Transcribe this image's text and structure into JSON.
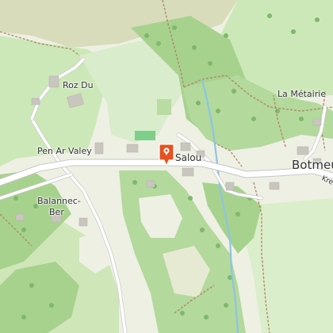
{
  "map": {
    "places": [
      {
        "name": "Roz Du",
        "kind": "hamlet"
      },
      {
        "name": "Pen Ar Valey",
        "kind": "locality"
      },
      {
        "name": "Salou",
        "kind": "locality"
      },
      {
        "name": "La Métairie",
        "kind": "hamlet"
      },
      {
        "name": "Botmeur",
        "kind": "village"
      },
      {
        "name": "Balannec-",
        "kind": "hamlet"
      },
      {
        "name": "Ber",
        "kind": "hamlet"
      }
    ],
    "road_labels": [
      {
        "name": "Kre"
      }
    ],
    "marker": {
      "type": "selected-location",
      "icon": "map-pin-icon",
      "color": "#e8501e"
    },
    "colors": {
      "background": "#eef0e4",
      "meadow": "#cde8b8",
      "forest": "#a7d28e",
      "scrub": "#d8dcbb",
      "road": "#ffffff",
      "road_casing": "#c9c9c9",
      "stream": "#8cc4e0",
      "track": "#b08968",
      "building": "#c9c6bf",
      "marker": "#e8501e"
    }
  }
}
